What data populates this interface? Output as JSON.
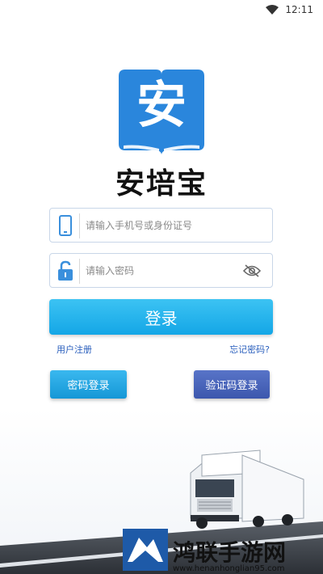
{
  "status_bar": {
    "time": "12:11"
  },
  "logo": {
    "char": "安",
    "brand_color": "#2a86dc"
  },
  "app": {
    "name": "安培宝"
  },
  "login_form": {
    "phone_placeholder": "请输入手机号或身份证号",
    "password_placeholder": "请输入密码",
    "login_label": "登录",
    "register_link": "用户注册",
    "forgot_link": "忘记密码?",
    "password_login_label": "密码登录",
    "code_login_label": "验证码登录"
  },
  "colors": {
    "accent": "#1da9e8",
    "link": "#2a5fbd",
    "secondary_button": "#4a65bd"
  },
  "watermark": {
    "title": "鸿联手游网",
    "url": "www.henanhonglian95.com"
  }
}
